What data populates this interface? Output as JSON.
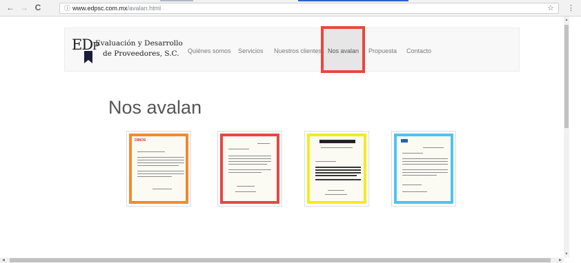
{
  "browser": {
    "back_icon": "←",
    "forward_icon": "→",
    "reload_icon": "C",
    "url_info_icon": "ⓘ",
    "url_host": "www.edpsc.com.mx",
    "url_path": "/avalan.html",
    "bookmark_icon": "☆",
    "menu_icon": "⋮"
  },
  "logo": {
    "mark_big": "ED",
    "mark_small": "P",
    "line1": "Evaluación y Desarrollo",
    "line2": "de Proveedores, S.C."
  },
  "nav": {
    "items": [
      {
        "label": "Quiénes somos"
      },
      {
        "label": "Servicios"
      },
      {
        "label": "Nuestros clientes"
      },
      {
        "label": "Nos avalan",
        "active": true
      },
      {
        "label": "Propuesta"
      },
      {
        "label": "Contacto"
      }
    ]
  },
  "page": {
    "heading": "Nos avalan"
  },
  "letters": [
    {
      "frame_color": "#f28a2e",
      "logo_text": "DIMOS",
      "logo_color": "#d8322e"
    },
    {
      "frame_color": "#e8473f",
      "logo_text": "",
      "logo_color": "#e8473f"
    },
    {
      "frame_color": "#f3eb21",
      "logo_text": "",
      "logo_color": "#222222"
    },
    {
      "frame_color": "#4fc3ef",
      "logo_text": "",
      "logo_color": "#2a5fb0"
    }
  ],
  "colors": {
    "highlight": "#e8473f",
    "chrome_accent": "#2f63c8"
  }
}
